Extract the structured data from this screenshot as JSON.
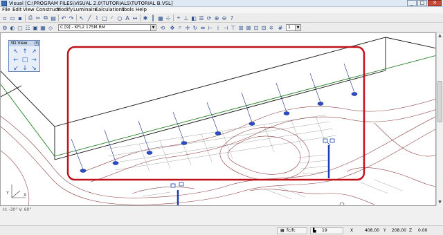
{
  "titlebar": {
    "app": "Visual",
    "path": "[C:\\PROGRAM FILES\\VISUAL 2.0\\TUTORIALS\\TUTORIAL B.VSL]"
  },
  "menu": [
    "File",
    "Edit",
    "View",
    "Construct",
    "Modify",
    "Luminaire",
    "Calculations",
    "Tools",
    "Help"
  ],
  "toolbar2": {
    "layer_combo": "C [9] - KFL2 175M RM",
    "zoom_value": "1"
  },
  "nav_panel": {
    "title": "3D View"
  },
  "viewport": {
    "view_angle": "H: -30° V: 60°",
    "axis_y": "Y",
    "axis_x": "X"
  },
  "statusbar": {
    "units": "fc/fc",
    "count_value": "19",
    "x_label": "X",
    "x_value": "408.00",
    "y_label": "Y",
    "y_value": "208.00",
    "z_label": "Z",
    "z_value": "0.00"
  },
  "colors": {
    "highlight": "#c0101a",
    "grid_line": "#7a1f1f",
    "curb_green": "#1d7a1d",
    "pole_blue": "#1a3fb0"
  }
}
